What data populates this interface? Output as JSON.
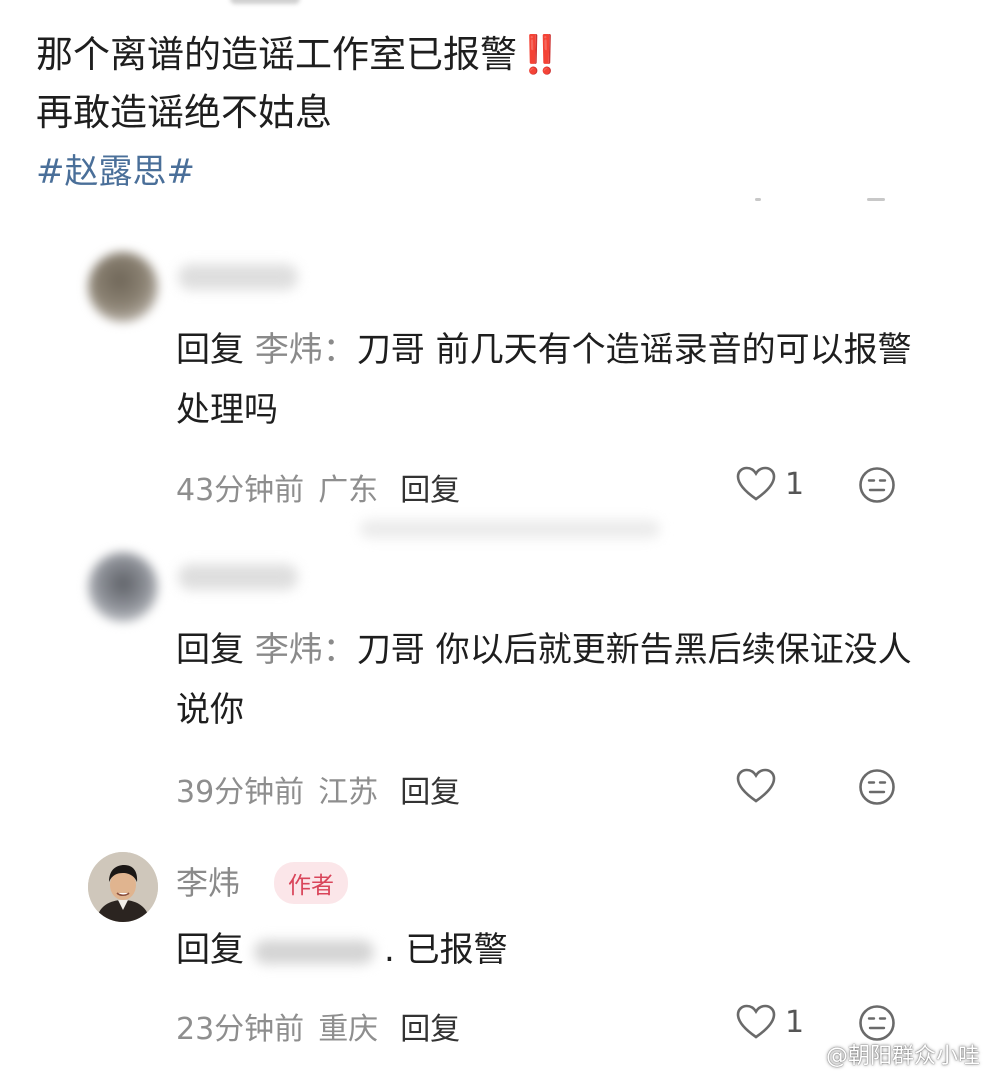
{
  "post": {
    "line1": "那个离谱的造谣工作室已报警",
    "line1_emoji": "‼️",
    "line2": "再敢造谣绝不姑息",
    "hashtag": "#赵露思#"
  },
  "comments": [
    {
      "reply_word": "回复",
      "mention": "李炜：",
      "body": "刀哥 前几天有个造谣录音的可以报警处理吗",
      "time": "43分钟前",
      "location": "广东",
      "reply_label": "回复",
      "likes": "1"
    },
    {
      "reply_word": "回复",
      "mention": "李炜：",
      "body": "刀哥 你以后就更新告黑后续保证没人说你",
      "time": "39分钟前",
      "location": "江苏",
      "reply_label": "回复",
      "likes": ""
    },
    {
      "author_name": "李炜",
      "author_badge": "作者",
      "reply_word": "回复",
      "body": ". 已报警",
      "time": "23分钟前",
      "location": "重庆",
      "reply_label": "回复",
      "likes": "1"
    }
  ],
  "watermark": "@朝阳群众小哇",
  "icons": {
    "like": "heart-outline-icon",
    "dislike": "meh-face-icon",
    "weibo": "weibo-logo-icon"
  }
}
